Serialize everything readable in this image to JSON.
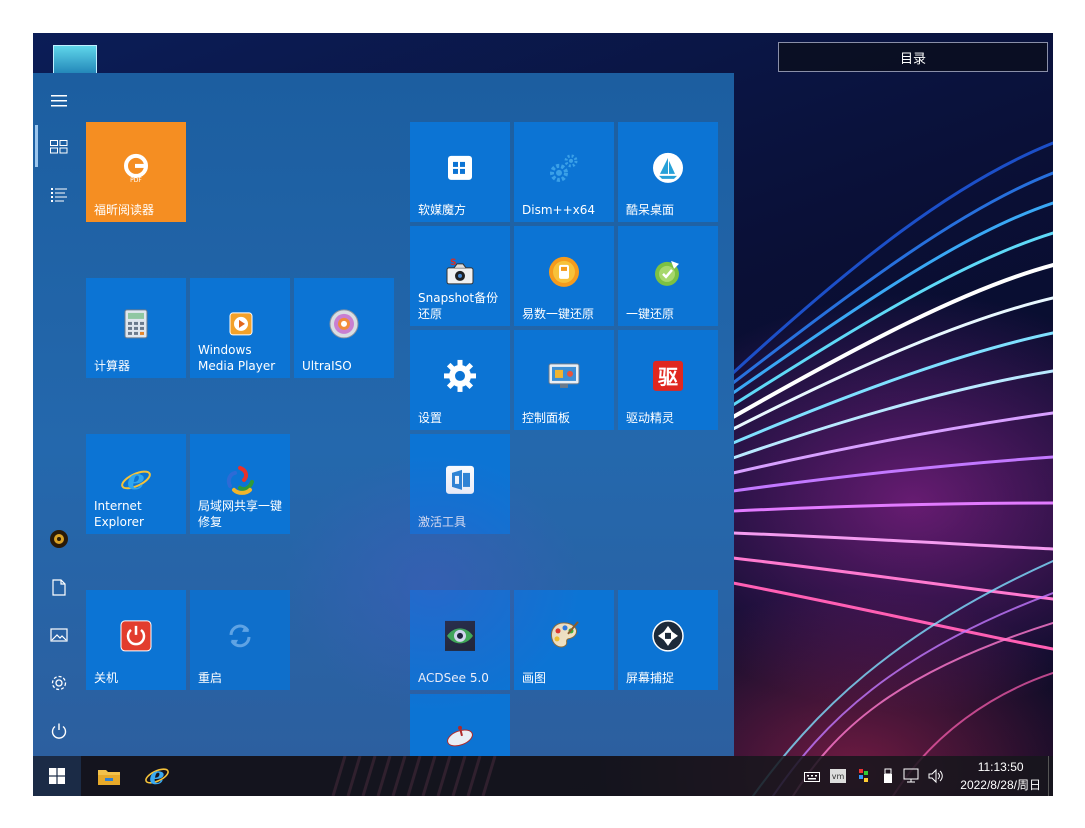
{
  "toc": {
    "label": "目录"
  },
  "rail": {
    "items": [
      "menu",
      "all-tiles",
      "list",
      "user",
      "documents",
      "pictures",
      "settings",
      "power"
    ]
  },
  "groups": {
    "left": [
      {
        "id": "foxit",
        "label": "福昕阅读器",
        "icon": "foxit-pdf-icon",
        "color": "#f58e22"
      },
      {
        "id": "calc",
        "label": "计算器",
        "icon": "calculator-icon"
      },
      {
        "id": "wmp",
        "label": "Windows\nMedia Player",
        "icon": "media-player-icon"
      },
      {
        "id": "ultraiso",
        "label": "UltraISO",
        "icon": "disc-icon"
      },
      {
        "id": "ie",
        "label": "Internet\nExplorer",
        "icon": "internet-explorer-icon"
      },
      {
        "id": "lanshare",
        "label": "局域网共享一键\n修复",
        "icon": "network-repair-icon"
      },
      {
        "id": "shutdown",
        "label": "关机",
        "icon": "power-off-icon"
      },
      {
        "id": "restart",
        "label": "重启",
        "icon": "restart-icon"
      }
    ],
    "right": [
      {
        "id": "ruanmei",
        "label": "软媒魔方",
        "icon": "cube-app-icon"
      },
      {
        "id": "dism",
        "label": "Dism++x64",
        "icon": "gears-icon"
      },
      {
        "id": "kudai",
        "label": "酷呆桌面",
        "icon": "sailboat-icon"
      },
      {
        "id": "snapshot",
        "label": "Snapshot备份\n还原",
        "icon": "snapshot-camera-icon"
      },
      {
        "id": "yishu",
        "label": "易数一键还原",
        "icon": "restore-orange-icon"
      },
      {
        "id": "yijian",
        "label": "一键还原",
        "icon": "restore-green-icon"
      },
      {
        "id": "settings",
        "label": "设置",
        "icon": "gear-icon"
      },
      {
        "id": "control",
        "label": "控制面板",
        "icon": "control-panel-icon"
      },
      {
        "id": "driver",
        "label": "驱动精灵",
        "icon": "driver-genius-icon"
      },
      {
        "id": "activate",
        "label": "激活工具",
        "icon": "office-activate-icon"
      },
      {
        "id": "acdsee",
        "label": "ACDSee 5.0",
        "icon": "acdsee-eye-icon"
      },
      {
        "id": "paint",
        "label": "画图",
        "icon": "paint-palette-icon"
      },
      {
        "id": "capture",
        "label": "屏幕捕捉",
        "icon": "camera-shutter-icon"
      },
      {
        "id": "partial",
        "label": "",
        "icon": "satellite-dish-icon"
      }
    ]
  },
  "taskbar": {
    "pinned": [
      "file-explorer-icon",
      "internet-explorer-icon"
    ],
    "tray": [
      "keyboard-icon",
      "vmware-icon",
      "color-app-icon",
      "usb-icon",
      "network-icon",
      "volume-icon"
    ],
    "time": "11:13:50",
    "date": "2022/8/28/周日"
  },
  "colors": {
    "tile": "#0c74d4",
    "accent_orange": "#f58e22",
    "menu_bg": "#1c5ea0"
  }
}
